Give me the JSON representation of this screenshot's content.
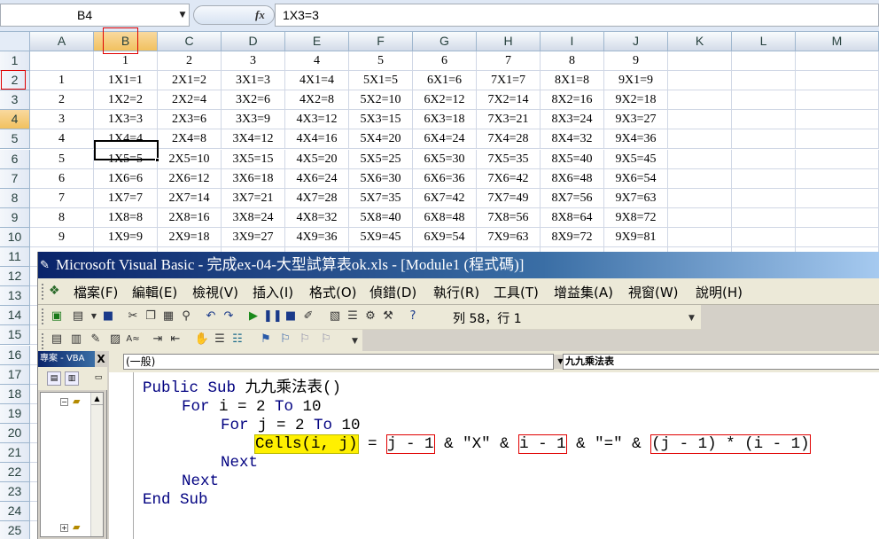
{
  "formula_bar": {
    "name_box": "B4",
    "fx_label": "fx",
    "formula": "1X3=3"
  },
  "columns": [
    "A",
    "B",
    "C",
    "D",
    "E",
    "F",
    "G",
    "H",
    "I",
    "J",
    "K",
    "L",
    "M"
  ],
  "rows": [
    "1",
    "2",
    "3",
    "4",
    "5",
    "6",
    "7",
    "8",
    "9",
    "10",
    "11",
    "12",
    "13",
    "14",
    "15",
    "16",
    "17",
    "18",
    "19",
    "20",
    "21",
    "22",
    "23",
    "24",
    "25"
  ],
  "selected_cell": "B4",
  "cells": {
    "row1": [
      "",
      "1",
      "2",
      "3",
      "4",
      "5",
      "6",
      "7",
      "8",
      "9"
    ],
    "row2": [
      "1",
      "1X1=1",
      "2X1=2",
      "3X1=3",
      "4X1=4",
      "5X1=5",
      "6X1=6",
      "7X1=7",
      "8X1=8",
      "9X1=9"
    ],
    "row3": [
      "2",
      "1X2=2",
      "2X2=4",
      "3X2=6",
      "4X2=8",
      "5X2=10",
      "6X2=12",
      "7X2=14",
      "8X2=16",
      "9X2=18"
    ],
    "row4": [
      "3",
      "1X3=3",
      "2X3=6",
      "3X3=9",
      "4X3=12",
      "5X3=15",
      "6X3=18",
      "7X3=21",
      "8X3=24",
      "9X3=27"
    ],
    "row5": [
      "4",
      "1X4=4",
      "2X4=8",
      "3X4=12",
      "4X4=16",
      "5X4=20",
      "6X4=24",
      "7X4=28",
      "8X4=32",
      "9X4=36"
    ],
    "row6": [
      "5",
      "1X5=5",
      "2X5=10",
      "3X5=15",
      "4X5=20",
      "5X5=25",
      "6X5=30",
      "7X5=35",
      "8X5=40",
      "9X5=45"
    ],
    "row7": [
      "6",
      "1X6=6",
      "2X6=12",
      "3X6=18",
      "4X6=24",
      "5X6=30",
      "6X6=36",
      "7X6=42",
      "8X6=48",
      "9X6=54"
    ],
    "row8": [
      "7",
      "1X7=7",
      "2X7=14",
      "3X7=21",
      "4X7=28",
      "5X7=35",
      "6X7=42",
      "7X7=49",
      "8X7=56",
      "9X7=63"
    ],
    "row9": [
      "8",
      "1X8=8",
      "2X8=16",
      "3X8=24",
      "4X8=32",
      "5X8=40",
      "6X8=48",
      "7X8=56",
      "8X8=64",
      "9X8=72"
    ],
    "row10": [
      "9",
      "1X9=9",
      "2X9=18",
      "3X9=27",
      "4X9=36",
      "5X9=45",
      "6X9=54",
      "7X9=63",
      "8X9=72",
      "9X9=81"
    ]
  },
  "vba": {
    "title": "Microsoft Visual Basic - 完成ex-04-大型試算表ok.xls - [Module1 (程式碼)]",
    "menus": [
      "檔案(F)",
      "編輯(E)",
      "檢視(V)",
      "插入(I)",
      "格式(O)",
      "偵錯(D)",
      "執行(R)",
      "工具(T)",
      "增益集(A)",
      "視窗(W)",
      "說明(H)"
    ],
    "cursor_position": "列 58，行 1",
    "project_title": "專案 - VBA",
    "close_label": "X",
    "object_dropdown": "(一般)",
    "procedure_dropdown": "九九乘法表",
    "code": {
      "line1_kw": "Public Sub",
      "line1_rest": " 九九乘法表()",
      "line2_kw1": "For",
      "line2_mid": " i = 2 ",
      "line2_kw2": "To",
      "line2_end": " 10",
      "line3_kw1": "For",
      "line3_mid": " j = 2 ",
      "line3_kw2": "To",
      "line3_end": " 10",
      "line4_cells": "Cells(i, j)",
      "line4_eq": " = ",
      "line4_a": "j - 1",
      "line4_b": " & \"X\" & ",
      "line4_c": "i - 1",
      "line4_d": " & \"=\" & ",
      "line4_e": "(j - 1) * (i - 1)",
      "line5_kw": "Next",
      "line6_kw": "Next",
      "line7_kw": "End Sub"
    }
  },
  "colors": {
    "highlight_yellow": "#fff000",
    "annotation_red": "#e00000",
    "vba_keyword": "#000080"
  }
}
